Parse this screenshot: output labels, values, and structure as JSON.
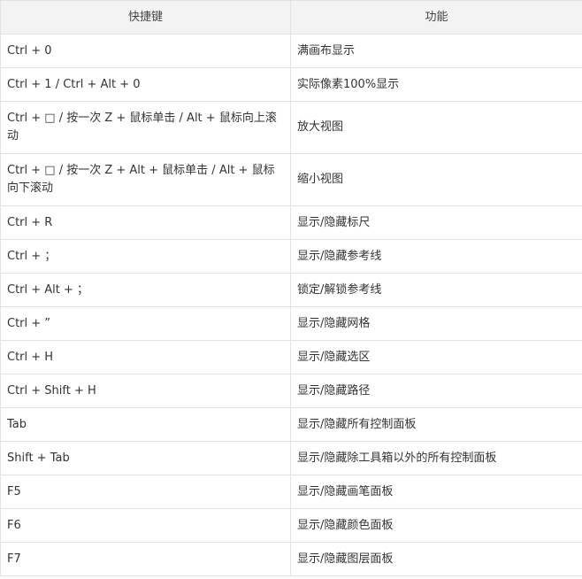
{
  "table": {
    "headers": [
      "快捷键",
      "功能"
    ],
    "rows": [
      {
        "key": "Ctrl + 0",
        "action": "满画布显示"
      },
      {
        "key": "Ctrl + 1 / Ctrl + Alt + 0",
        "action": "实际像素100%显示"
      },
      {
        "key": "Ctrl + □ / 按一次 Z + 鼠标单击 / Alt + 鼠标向上滚动",
        "action": "放大视图"
      },
      {
        "key": "Ctrl + □ / 按一次 Z + Alt + 鼠标单击 / Alt + 鼠标向下滚动",
        "action": "缩小视图"
      },
      {
        "key": "Ctrl + R",
        "action": "显示/隐藏标尺"
      },
      {
        "key": "Ctrl + ；",
        "action": "显示/隐藏参考线"
      },
      {
        "key": "Ctrl + Alt + ；",
        "action": "锁定/解锁参考线"
      },
      {
        "key": "Ctrl + ”",
        "action": "显示/隐藏网格"
      },
      {
        "key": "Ctrl + H",
        "action": "显示/隐藏选区"
      },
      {
        "key": "Ctrl + Shift + H",
        "action": "显示/隐藏路径"
      },
      {
        "key": "Tab",
        "action": "显示/隐藏所有控制面板"
      },
      {
        "key": "Shift + Tab",
        "action": "显示/隐藏除工具箱以外的所有控制面板"
      },
      {
        "key": "F5",
        "action": "显示/隐藏画笔面板"
      },
      {
        "key": "F6",
        "action": "显示/隐藏颜色面板"
      },
      {
        "key": "F7",
        "action": "显示/隐藏图层面板"
      }
    ]
  }
}
